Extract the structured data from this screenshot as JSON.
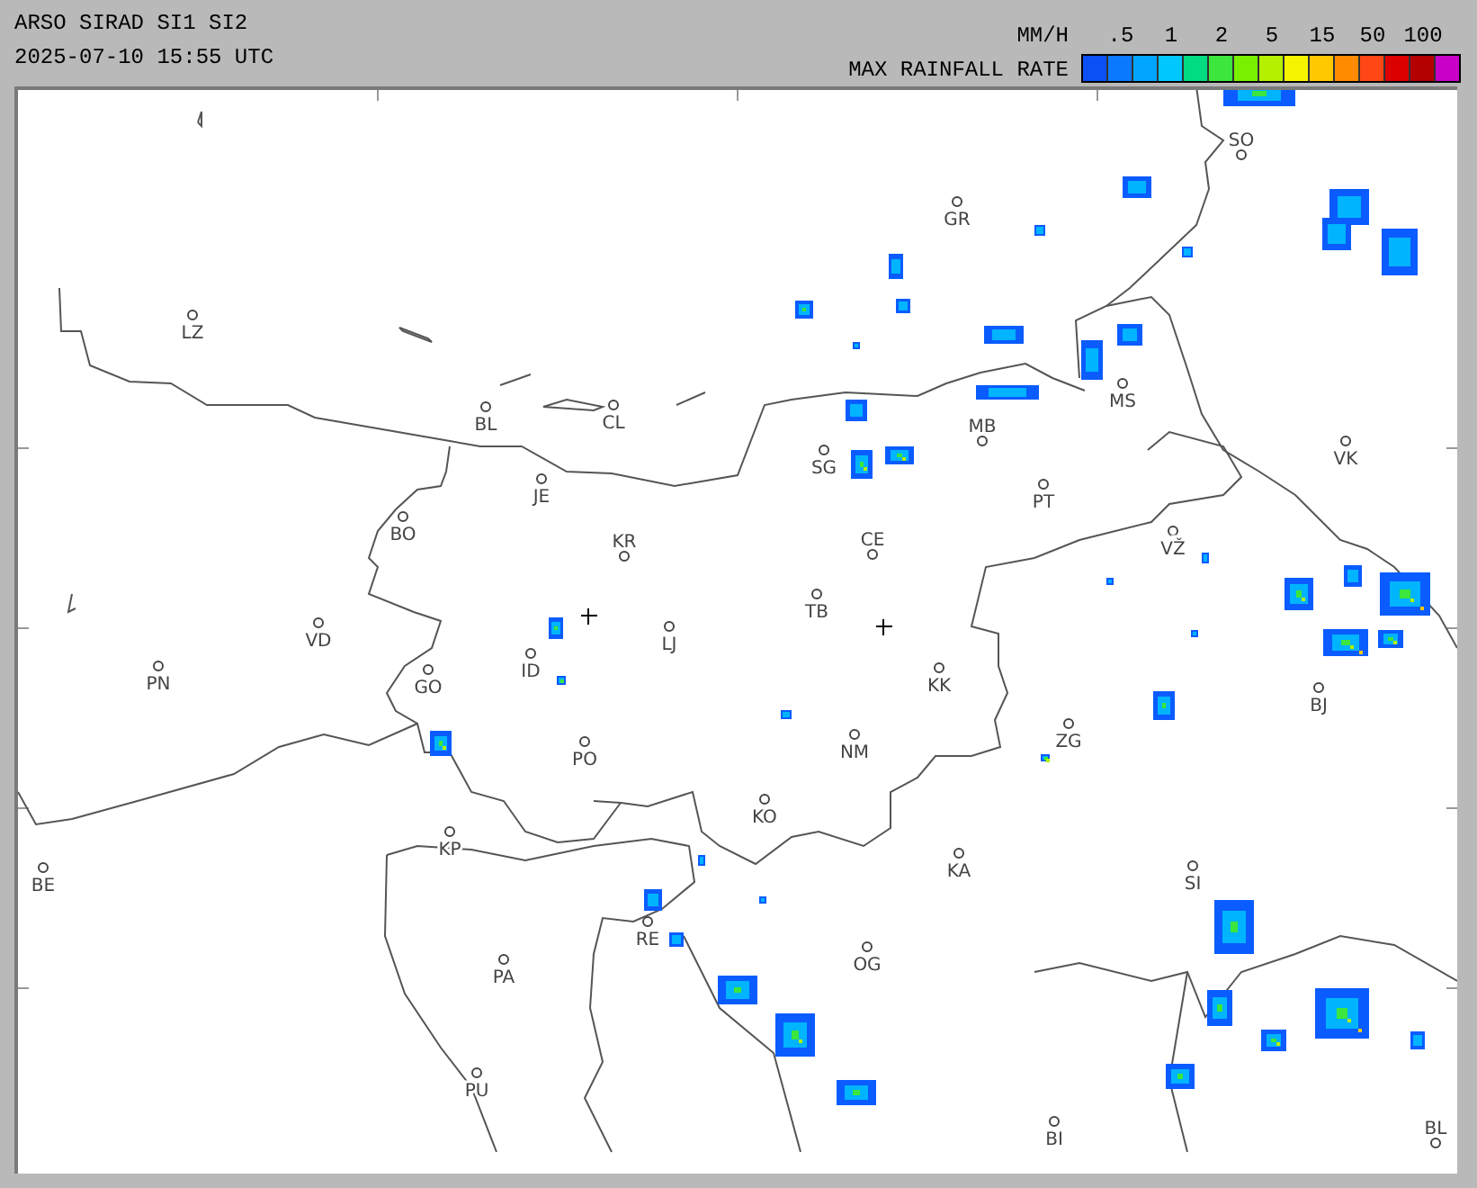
{
  "header": {
    "title": "ARSO SIRAD SI1 SI2",
    "timestamp": "2025-07-10 15:55 UTC"
  },
  "legend": {
    "unit": "MM/H",
    "caption": "MAX RAINFALL RATE",
    "labels": [
      ".5",
      "1",
      "2",
      "5",
      "15",
      "50",
      "100"
    ],
    "swatches": [
      {
        "color": "#0a50f5"
      },
      {
        "color": "#0a78ff"
      },
      {
        "color": "#00a5ff"
      },
      {
        "color": "#00c8ff"
      },
      {
        "color": "#00dc82"
      },
      {
        "color": "#3ce63c"
      },
      {
        "color": "#78f000"
      },
      {
        "color": "#b4f000"
      },
      {
        "color": "#f5f500"
      },
      {
        "color": "#ffc800"
      },
      {
        "color": "#ff8c00"
      },
      {
        "color": "#ff4614"
      },
      {
        "color": "#dc0000"
      },
      {
        "color": "#b40000"
      },
      {
        "color": "#c800c8"
      }
    ]
  },
  "map": {
    "cities": [
      {
        "label": "SO"
      },
      {
        "label": "GR"
      },
      {
        "label": "LZ"
      },
      {
        "label": "BL"
      },
      {
        "label": "CL"
      },
      {
        "label": "MB"
      },
      {
        "label": "MS"
      },
      {
        "label": "SG"
      },
      {
        "label": "JE"
      },
      {
        "label": "VK"
      },
      {
        "label": "PT"
      },
      {
        "label": "BO"
      },
      {
        "label": "KR"
      },
      {
        "label": "CE"
      },
      {
        "label": "VŽ"
      },
      {
        "label": "TB"
      },
      {
        "label": "VD"
      },
      {
        "label": "LJ"
      },
      {
        "label": "ID"
      },
      {
        "label": "PN"
      },
      {
        "label": "GO"
      },
      {
        "label": "KK"
      },
      {
        "label": "BJ"
      },
      {
        "label": "ZG"
      },
      {
        "label": "NM"
      },
      {
        "label": "PO"
      },
      {
        "label": "KO"
      },
      {
        "label": "KP"
      },
      {
        "label": "KA"
      },
      {
        "label": "BE"
      },
      {
        "label": "SI"
      },
      {
        "label": "RE"
      },
      {
        "label": "OG"
      },
      {
        "label": "PA"
      },
      {
        "label": "PU"
      },
      {
        "label": "BI"
      },
      {
        "label": "BL"
      }
    ]
  }
}
